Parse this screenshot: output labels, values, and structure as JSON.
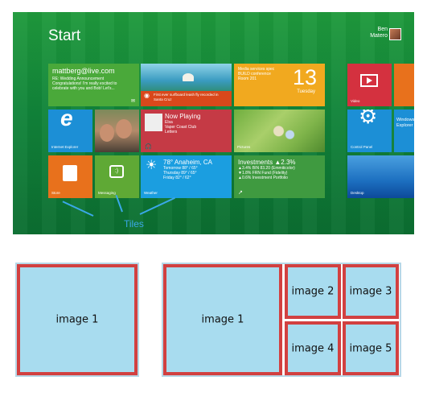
{
  "start_screen": {
    "title": "Start",
    "user": {
      "first": "Ben",
      "last": "Matero"
    },
    "tiles": {
      "mail": {
        "address": "mattberg@live.com",
        "lines": [
          "RE: Wedding Announcement",
          "Congratulations! I'm really excited to",
          "celebrate with you and Bob! Let's..."
        ]
      },
      "photo_caption": "First ever surfboard leash fly recorded in Santa Cruz",
      "calendar": {
        "lines": [
          "Media services spec",
          "BUILD conference",
          "Room 201"
        ],
        "number": "13",
        "day": "Tuesday"
      },
      "internet_explorer": "Internet Explorer",
      "now_playing": {
        "title": "Now Playing",
        "artist": "Elsa",
        "album": "Vaper Coast Club",
        "track": "Letters"
      },
      "store": "Store",
      "messaging": "Messaging",
      "weather": {
        "title": "78° Anaheim, CA",
        "lines": [
          "Tomorrow 88° / 65°",
          "Thursday 89° / 65°",
          "Friday 82° / 62°"
        ],
        "label": "Weather"
      },
      "investments": {
        "title": "Investments ▲2.3%",
        "lines": [
          "▲3.4%   BIN 83.20 (Emmiticolor)",
          "▼1.8%   FRN Fund (Fidelity)",
          "▲0.6%   Investment Portfolio"
        ]
      },
      "pictures": "Pictures",
      "video": "Video",
      "control_panel": "Control Panel",
      "windows_explorer": "Windows Explorer",
      "desktop": "Desktop"
    },
    "annotation": "Tiles"
  },
  "layouts": {
    "left": {
      "image1": "image 1"
    },
    "right": {
      "image1": "image 1",
      "image2": "image 2",
      "image3": "image 3",
      "image4": "image 4",
      "image5": "image 5"
    }
  },
  "colors": {
    "tile_border": "#d24040",
    "tile_fill": "#a8dcef",
    "start_bg": "#11843a",
    "annotation": "#3aa8e8"
  }
}
